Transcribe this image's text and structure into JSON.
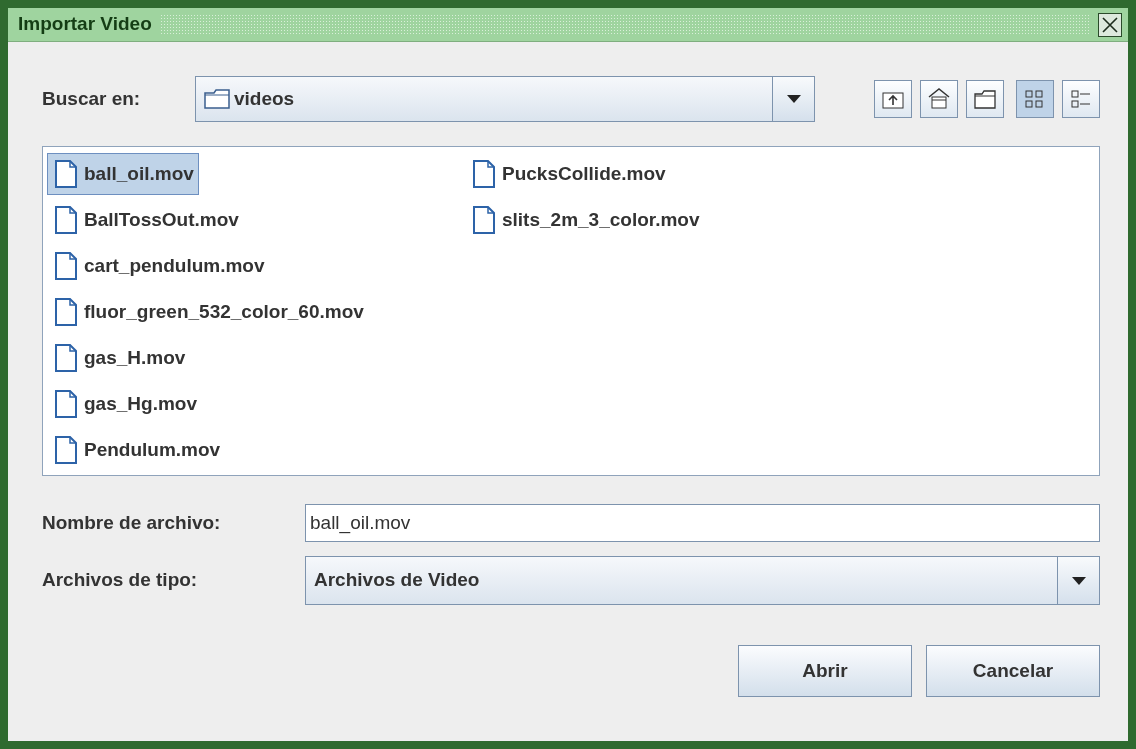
{
  "window": {
    "title": "Importar Video"
  },
  "look_in": {
    "label": "Buscar en:",
    "value": "videos"
  },
  "toolbar_buttons": [
    {
      "kind": "up"
    },
    {
      "kind": "home"
    },
    {
      "kind": "new_folder"
    }
  ],
  "view_buttons": [
    {
      "kind": "list",
      "selected": true
    },
    {
      "kind": "details",
      "selected": false
    }
  ],
  "files": [
    {
      "name": "ball_oil.mov",
      "selected": true
    },
    {
      "name": "BallTossOut.mov",
      "selected": false
    },
    {
      "name": "cart_pendulum.mov",
      "selected": false
    },
    {
      "name": "fluor_green_532_color_60.mov",
      "selected": false
    },
    {
      "name": "gas_H.mov",
      "selected": false
    },
    {
      "name": "gas_Hg.mov",
      "selected": false
    },
    {
      "name": "Pendulum.mov",
      "selected": false
    },
    {
      "name": "PucksCollide.mov",
      "selected": false
    },
    {
      "name": "slits_2m_3_color.mov",
      "selected": false
    }
  ],
  "file_name": {
    "label": "Nombre de archivo:",
    "value": "ball_oil.mov"
  },
  "file_type": {
    "label": "Archivos de tipo:",
    "value": "Archivos de Video"
  },
  "buttons": [
    "Abrir",
    "Cancelar"
  ]
}
